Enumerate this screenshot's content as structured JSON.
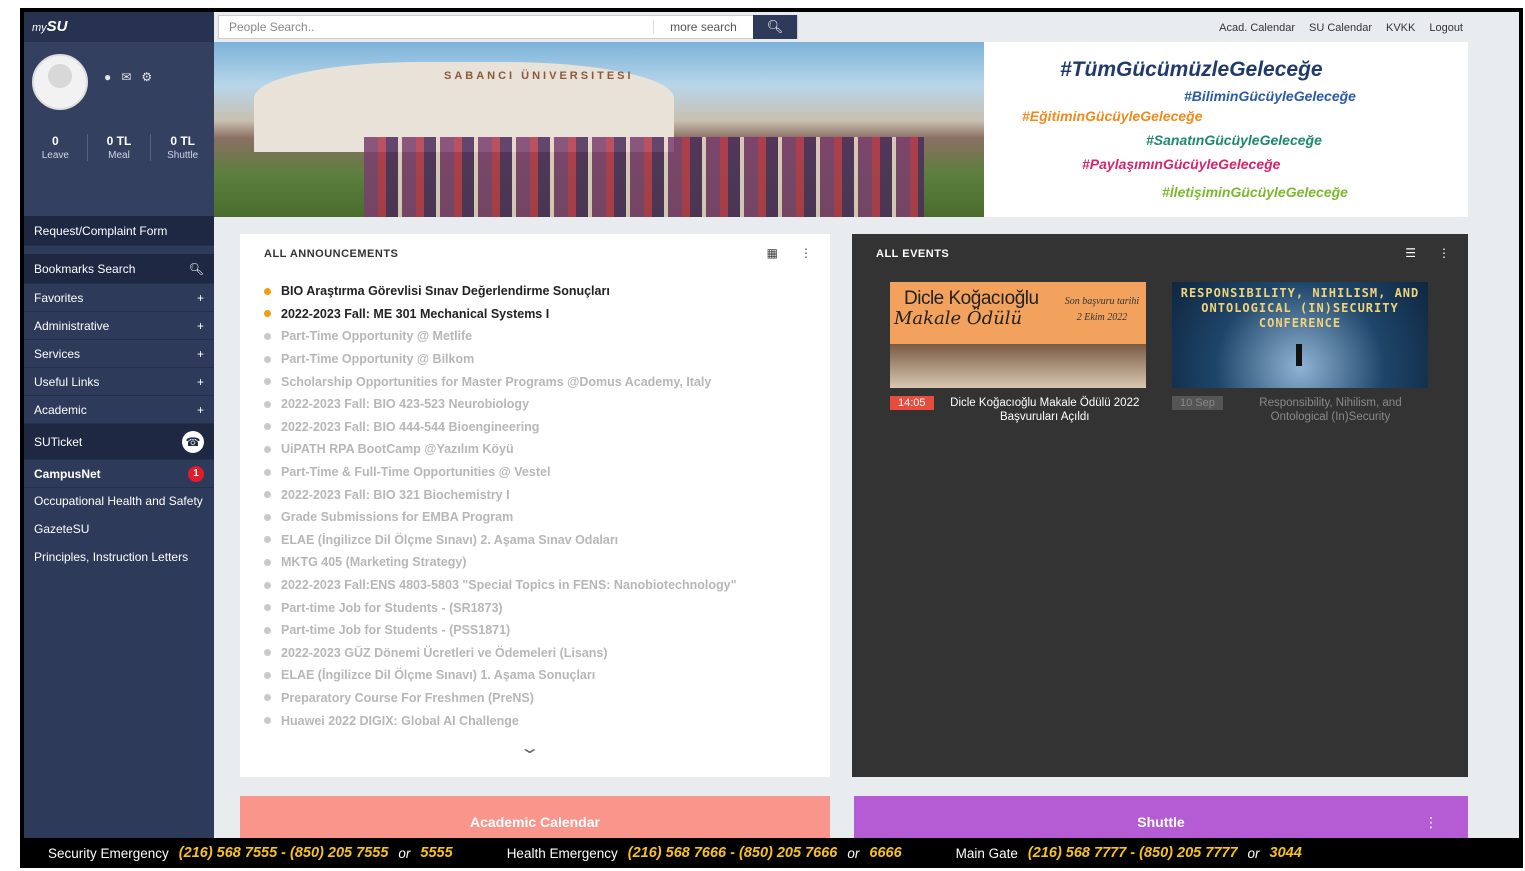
{
  "logo": {
    "prefix": "my",
    "name": "SU"
  },
  "profile": {
    "stats": [
      {
        "value": "0",
        "label": "Leave"
      },
      {
        "value": "0 TL",
        "label": "Meal"
      },
      {
        "value": "0 TL",
        "label": "Shuttle"
      }
    ]
  },
  "sidebar": {
    "request_form": "Request/Complaint Form",
    "bookmarks_search": "Bookmarks Search",
    "collapsible": [
      {
        "label": "Favorites",
        "toggle": "+"
      },
      {
        "label": "Administrative",
        "toggle": "+"
      },
      {
        "label": "Services",
        "toggle": "+"
      },
      {
        "label": "Useful Links",
        "toggle": "+"
      },
      {
        "label": "Academic",
        "toggle": "+"
      }
    ],
    "suticket": "SUTicket",
    "campusnet": {
      "label": "CampusNet",
      "badge": "1"
    },
    "links": [
      "Occupational Health and Safety",
      "GazeteSU",
      "Principles, Instruction Letters"
    ]
  },
  "search": {
    "placeholder": "People Search..",
    "more": "more search"
  },
  "toplinks": [
    "Acad. Calendar",
    "SU Calendar",
    "KVKK",
    "Logout"
  ],
  "banner": {
    "sign": "SABANCI ÜNIVERSITESI",
    "hashtags": [
      {
        "text": "#TümGücümüzleGeleceğe",
        "color": "#1f3a6b"
      },
      {
        "text": "#BiliminGücüyleGeleceğe",
        "color": "#2a5aa8"
      },
      {
        "text": "#EğitiminGücüyleGeleceğe",
        "color": "#f08a1c"
      },
      {
        "text": "#SanatınGücüyleGeleceğe",
        "color": "#1b8a6b"
      },
      {
        "text": "#PaylaşımınGücüyleGeleceğe",
        "color": "#d6246e"
      },
      {
        "text": "#İletişiminGücüyleGeleceğe",
        "color": "#7cb82f"
      }
    ]
  },
  "announcements": {
    "title": "ALL ANNOUNCEMENTS",
    "items": [
      {
        "text": "BIO Araştırma Görevlisi Sınav Değerlendirme Sonuçları",
        "new": true
      },
      {
        "text": "2022-2023 Fall: ME 301 Mechanical Systems I",
        "new": true
      },
      {
        "text": "Part-Time Opportunity @ Metlife",
        "new": false
      },
      {
        "text": "Part-Time Opportunity @ Bilkom",
        "new": false
      },
      {
        "text": "Scholarship Opportunities for Master Programs @Domus Academy, Italy",
        "new": false
      },
      {
        "text": "2022-2023 Fall: BIO 423-523 Neurobiology",
        "new": false
      },
      {
        "text": "2022-2023 Fall: BIO 444-544 Bioengineering",
        "new": false
      },
      {
        "text": "UiPATH RPA BootCamp @Yazılım Köyü",
        "new": false
      },
      {
        "text": "Part-Time & Full-Time Opportunities @ Vestel",
        "new": false
      },
      {
        "text": "2022-2023 Fall: BIO 321 Biochemistry I",
        "new": false
      },
      {
        "text": "Grade Submissions for EMBA Program",
        "new": false
      },
      {
        "text": "ELAE (İngilizce Dil Ölçme Sınavı) 2. Aşama Sınav Odaları",
        "new": false
      },
      {
        "text": "MKTG 405 (Marketing Strategy)",
        "new": false
      },
      {
        "text": "2022-2023 Fall:ENS 4803-5803 \"Special Topics in FENS: Nanobiotechnology\"",
        "new": false
      },
      {
        "text": "Part-time Job for Students - (SR1873)",
        "new": false
      },
      {
        "text": "Part-time Job for Students - (PSS1871)",
        "new": false
      },
      {
        "text": "2022-2023 GÜZ Dönemi Ücretleri ve Ödemeleri (Lisans)",
        "new": false
      },
      {
        "text": "ELAE (İngilizce Dil Ölçme Sınavı) 1. Aşama Sonuçları",
        "new": false
      },
      {
        "text": "Preparatory Course For Freshmen (PreNS)",
        "new": false
      },
      {
        "text": "Huawei 2022 DIGIX: Global AI Challenge",
        "new": false
      }
    ]
  },
  "events": {
    "title": "ALL EVENTS",
    "items": [
      {
        "image_title": "Dicle Koğacıoğlu",
        "image_subtitle": "Makale Ödülü",
        "image_note": "Son başvuru tarihi 2 Ekim 2022",
        "time": "14:05",
        "title": "Dicle Koğacıoğlu Makale Ödülü 2022 Başvuruları Açıldı"
      },
      {
        "image_title": "RESPONSIBILITY, NIHILISM, AND ONTOLOGICAL (IN)SECURITY CONFERENCE",
        "time": "10 Sep",
        "title": "Responsibility, Nihilism, and Ontological (In)Security"
      }
    ]
  },
  "cards": {
    "calendar": "Academic Calendar",
    "shuttle": "Shuttle"
  },
  "footer": [
    {
      "label": "Security Emergency",
      "phones": "(216) 568 7555 - (850) 205 7555",
      "or": "or",
      "ext": "5555"
    },
    {
      "label": "Health Emergency",
      "phones": "(216) 568 7666 - (850) 205 7666",
      "or": "or",
      "ext": "6666"
    },
    {
      "label": "Main Gate",
      "phones": "(216) 568 7777 - (850) 205 7777",
      "or": "or",
      "ext": "3044"
    }
  ]
}
